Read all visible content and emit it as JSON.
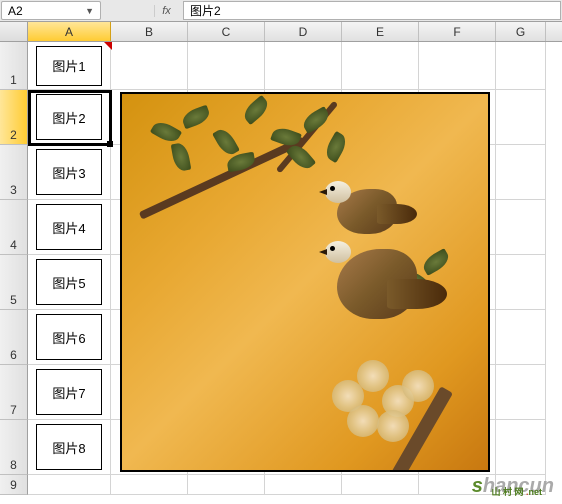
{
  "formula_bar": {
    "name_box": "A2",
    "fx_label": "fx",
    "formula_value": "图片2"
  },
  "columns": [
    "A",
    "B",
    "C",
    "D",
    "E",
    "F",
    "G"
  ],
  "rows": [
    "1",
    "2",
    "3",
    "4",
    "5",
    "6",
    "7",
    "8",
    "9"
  ],
  "selected_column": "A",
  "selected_row": "2",
  "cells": {
    "A1": "图片1",
    "A2": "图片2",
    "A3": "图片3",
    "A4": "图片4",
    "A5": "图片5",
    "A6": "图片6",
    "A7": "图片7",
    "A8": "图片8"
  },
  "watermark": {
    "first": "s",
    "rest": "hancun",
    "sub": "山 村 网",
    "dot": ".",
    "tld": "net"
  }
}
